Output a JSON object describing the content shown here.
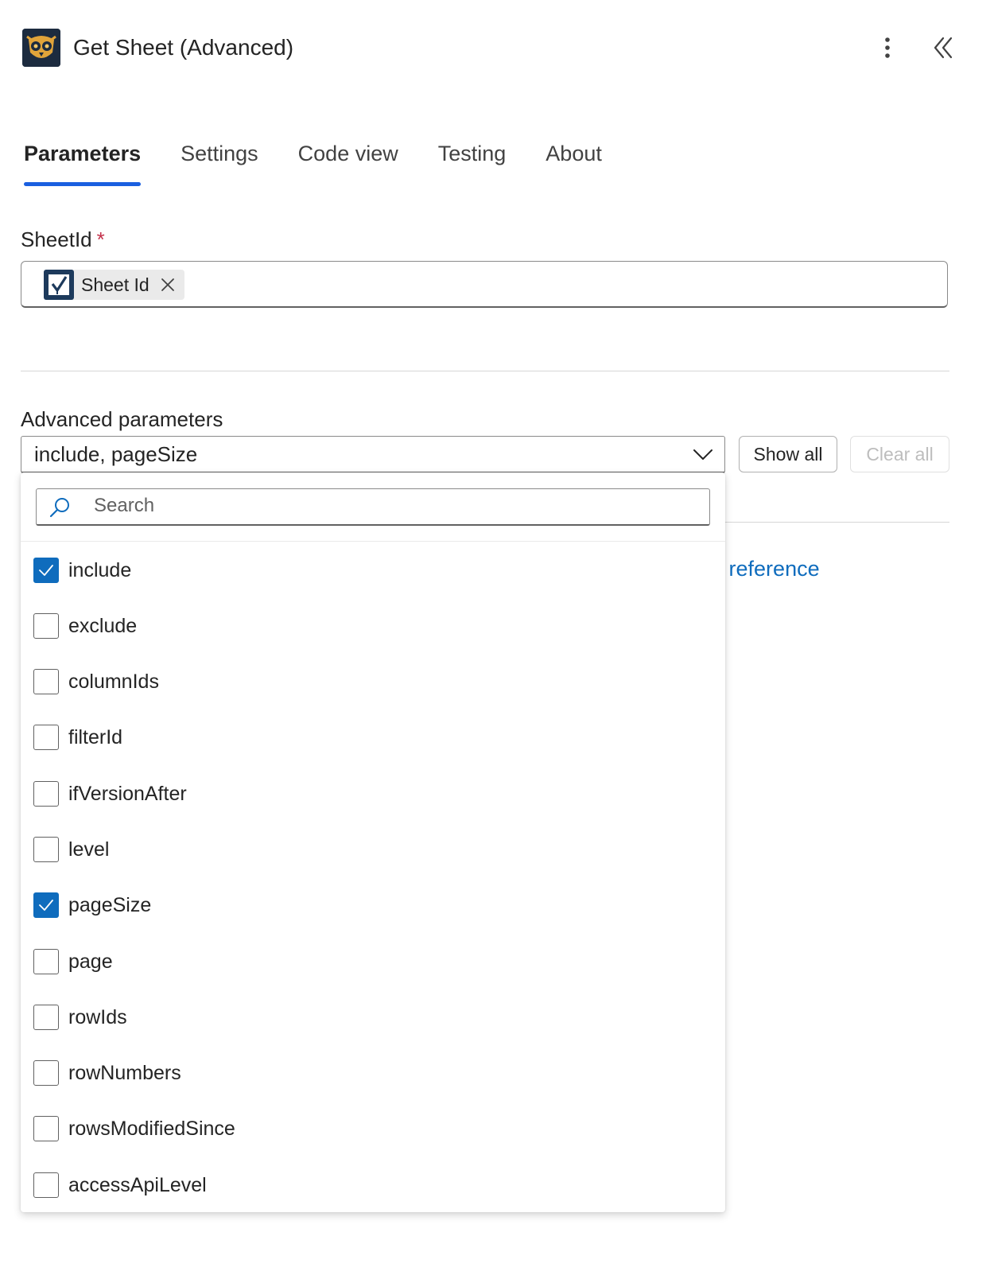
{
  "header": {
    "title": "Get Sheet (Advanced)",
    "logo_icon": "owl-logo-icon",
    "more_icon": "more-vertical-icon",
    "collapse_icon": "double-chevron-left-icon"
  },
  "tabs": [
    {
      "label": "Parameters",
      "active": true
    },
    {
      "label": "Settings",
      "active": false
    },
    {
      "label": "Code view",
      "active": false
    },
    {
      "label": "Testing",
      "active": false
    },
    {
      "label": "About",
      "active": false
    }
  ],
  "sheet_id": {
    "label": "SheetId",
    "required_mark": "*",
    "token_label": "Sheet Id",
    "token_icon": "smartsheet-icon"
  },
  "advanced": {
    "label": "Advanced parameters",
    "selected_value": "include, pageSize",
    "show_all_label": "Show all",
    "clear_all_label": "Clear all",
    "search_placeholder": "Search",
    "options": [
      {
        "label": "include",
        "checked": true
      },
      {
        "label": "exclude",
        "checked": false
      },
      {
        "label": "columnIds",
        "checked": false
      },
      {
        "label": "filterId",
        "checked": false
      },
      {
        "label": "ifVersionAfter",
        "checked": false
      },
      {
        "label": "level",
        "checked": false
      },
      {
        "label": "pageSize",
        "checked": true
      },
      {
        "label": "page",
        "checked": false
      },
      {
        "label": "rowIds",
        "checked": false
      },
      {
        "label": "rowNumbers",
        "checked": false
      },
      {
        "label": "rowsModifiedSince",
        "checked": false
      },
      {
        "label": "accessApiLevel",
        "checked": false
      }
    ]
  },
  "reference_link": "on reference",
  "colors": {
    "accent": "#1a5fe0",
    "checkbox": "#0f6cbd",
    "link": "#0f6cbd",
    "required": "#c4314b"
  }
}
